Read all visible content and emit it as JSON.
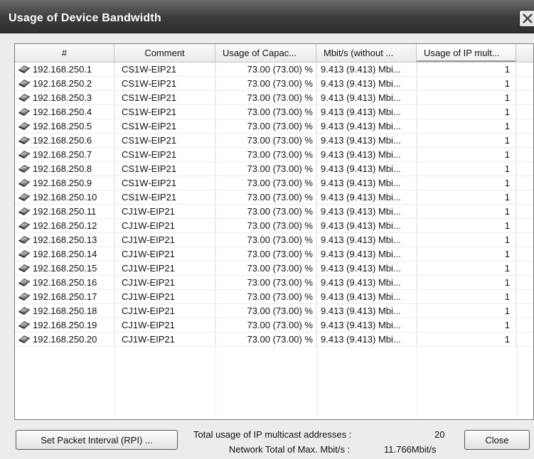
{
  "window": {
    "title": "Usage of Device Bandwidth"
  },
  "table": {
    "columns": [
      "#",
      "Comment",
      "Usage of Capac...",
      "Mbit/s (without ...",
      "Usage of IP mult..."
    ],
    "rows": [
      [
        "192.168.250.1",
        "CS1W-EIP21",
        "73.00 (73.00) %",
        "9.413 (9.413) Mbi...",
        "1"
      ],
      [
        "192.168.250.2",
        "CS1W-EIP21",
        "73.00 (73.00) %",
        "9.413 (9.413) Mbi...",
        "1"
      ],
      [
        "192.168.250.3",
        "CS1W-EIP21",
        "73.00 (73.00) %",
        "9.413 (9.413) Mbi...",
        "1"
      ],
      [
        "192.168.250.4",
        "CS1W-EIP21",
        "73.00 (73.00) %",
        "9.413 (9.413) Mbi...",
        "1"
      ],
      [
        "192.168.250.5",
        "CS1W-EIP21",
        "73.00 (73.00) %",
        "9.413 (9.413) Mbi...",
        "1"
      ],
      [
        "192.168.250.6",
        "CS1W-EIP21",
        "73.00 (73.00) %",
        "9.413 (9.413) Mbi...",
        "1"
      ],
      [
        "192.168.250.7",
        "CS1W-EIP21",
        "73.00 (73.00) %",
        "9.413 (9.413) Mbi...",
        "1"
      ],
      [
        "192.168.250.8",
        "CS1W-EIP21",
        "73.00 (73.00) %",
        "9.413 (9.413) Mbi...",
        "1"
      ],
      [
        "192.168.250.9",
        "CS1W-EIP21",
        "73.00 (73.00) %",
        "9.413 (9.413) Mbi...",
        "1"
      ],
      [
        "192.168.250.10",
        "CS1W-EIP21",
        "73.00 (73.00) %",
        "9.413 (9.413) Mbi...",
        "1"
      ],
      [
        "192.168.250.11",
        "CJ1W-EIP21",
        "73.00 (73.00) %",
        "9.413 (9.413) Mbi...",
        "1"
      ],
      [
        "192.168.250.12",
        "CJ1W-EIP21",
        "73.00 (73.00) %",
        "9.413 (9.413) Mbi...",
        "1"
      ],
      [
        "192.168.250.13",
        "CJ1W-EIP21",
        "73.00 (73.00) %",
        "9.413 (9.413) Mbi...",
        "1"
      ],
      [
        "192.168.250.14",
        "CJ1W-EIP21",
        "73.00 (73.00) %",
        "9.413 (9.413) Mbi...",
        "1"
      ],
      [
        "192.168.250.15",
        "CJ1W-EIP21",
        "73.00 (73.00) %",
        "9.413 (9.413) Mbi...",
        "1"
      ],
      [
        "192.168.250.16",
        "CJ1W-EIP21",
        "73.00 (73.00) %",
        "9.413 (9.413) Mbi...",
        "1"
      ],
      [
        "192.168.250.17",
        "CJ1W-EIP21",
        "73.00 (73.00) %",
        "9.413 (9.413) Mbi...",
        "1"
      ],
      [
        "192.168.250.18",
        "CJ1W-EIP21",
        "73.00 (73.00) %",
        "9.413 (9.413) Mbi...",
        "1"
      ],
      [
        "192.168.250.19",
        "CJ1W-EIP21",
        "73.00 (73.00) %",
        "9.413 (9.413) Mbi...",
        "1"
      ],
      [
        "192.168.250.20",
        "CJ1W-EIP21",
        "73.00 (73.00) %",
        "9.413 (9.413) Mbi...",
        "1"
      ]
    ],
    "row_icon": "device-icon",
    "active_sort_column": "Usage of IP mult..."
  },
  "footer": {
    "rpi_button_label": "Set Packet Interval (RPI) ...",
    "multicast_label": "Total usage of IP multicast addresses :",
    "multicast_value": "20",
    "network_label": "Network Total of Max. Mbit/s :",
    "network_value": "11.766Mbit/s",
    "close_button_label": "Close"
  },
  "icons": {
    "title_close": "close-icon"
  }
}
